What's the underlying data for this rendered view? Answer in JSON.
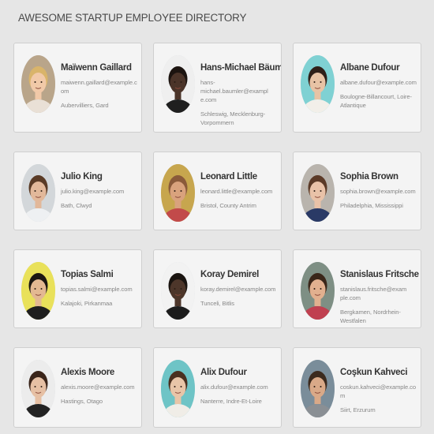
{
  "header": {
    "title": "AWESOME STARTUP EMPLOYEE DIRECTORY"
  },
  "employees": [
    {
      "name": "Maïwenn Gaillard",
      "email": "maiwenn.gaillard@example.com",
      "location": "Aubervilliers, Gard",
      "skin": "#f1c9a8",
      "hair": "#d9b46a",
      "bg": "#b9a58a",
      "shirt": "#e9e0d6"
    },
    {
      "name": "Hans-Michael Bäumler",
      "email": "hans-michael.baumler@example.com",
      "location": "Schleswig, Mecklenburg-Vorpommern",
      "skin": "#4b3429",
      "hair": "#1c1410",
      "bg": "#efefef",
      "shirt": "#1f1f1f"
    },
    {
      "name": "Albane Dufour",
      "email": "albane.dufour@example.com",
      "location": "Boulogne-Billancourt, Loire-Atlantique",
      "skin": "#e7c3a5",
      "hair": "#2e2019",
      "bg": "#7fd1d3",
      "shirt": "#f2efe9"
    },
    {
      "name": "Julio King",
      "email": "julio.king@example.com",
      "location": "Bath, Clwyd",
      "skin": "#e2b89a",
      "hair": "#5a3b26",
      "bg": "#d3d7da",
      "shirt": "#eef0f2"
    },
    {
      "name": "Leonard Little",
      "email": "leonard.little@example.com",
      "location": "Bristol, County Antrim",
      "skin": "#d9a27d",
      "hair": "#8a5a3a",
      "bg": "#c7a64e",
      "shirt": "#c24a4a"
    },
    {
      "name": "Sophia Brown",
      "email": "sophia.brown@example.com",
      "location": "Philadelphia, Mississippi",
      "skin": "#e9c2a8",
      "hair": "#5b3a27",
      "bg": "#b9b4ad",
      "shirt": "#2a3a66"
    },
    {
      "name": "Topias Salmi",
      "email": "topias.salmi@example.com",
      "location": "Kalajoki, Pirkanmaa",
      "skin": "#e3b892",
      "hair": "#1c1712",
      "bg": "#e9e15a",
      "shirt": "#1e1e1e"
    },
    {
      "name": "Koray Demirel",
      "email": "koray.demirel@example.com",
      "location": "Tunceli, Bitlis",
      "skin": "#4d362a",
      "hair": "#1a1410",
      "bg": "#f2f2f2",
      "shirt": "#1c1c1c"
    },
    {
      "name": "Stanislaus Fritsche",
      "email": "stanislaus.fritsche@example.com",
      "location": "Bergkamen, Nordrhein-Westfalen",
      "skin": "#e1b08f",
      "hair": "#3a2619",
      "bg": "#7e8f84",
      "shirt": "#c04050"
    },
    {
      "name": "Alexis Moore",
      "email": "alexis.moore@example.com",
      "location": "Hastings, Otago",
      "skin": "#e6c0a4",
      "hair": "#3a2419",
      "bg": "#ececec",
      "shirt": "#222"
    },
    {
      "name": "Alix Dufour",
      "email": "alix.dufour@example.com",
      "location": "Nanterre, Indre-Et-Loire",
      "skin": "#e8c5a8",
      "hair": "#4a3020",
      "bg": "#6ec4c6",
      "shirt": "#f0ede7"
    },
    {
      "name": "Coşkun Kahveci",
      "email": "coskun.kahveci@example.com",
      "location": "Siirt, Erzurum",
      "skin": "#d9a988",
      "hair": "#3b2a1e",
      "bg": "#7a8d9a",
      "shirt": "#8a8f94"
    }
  ]
}
